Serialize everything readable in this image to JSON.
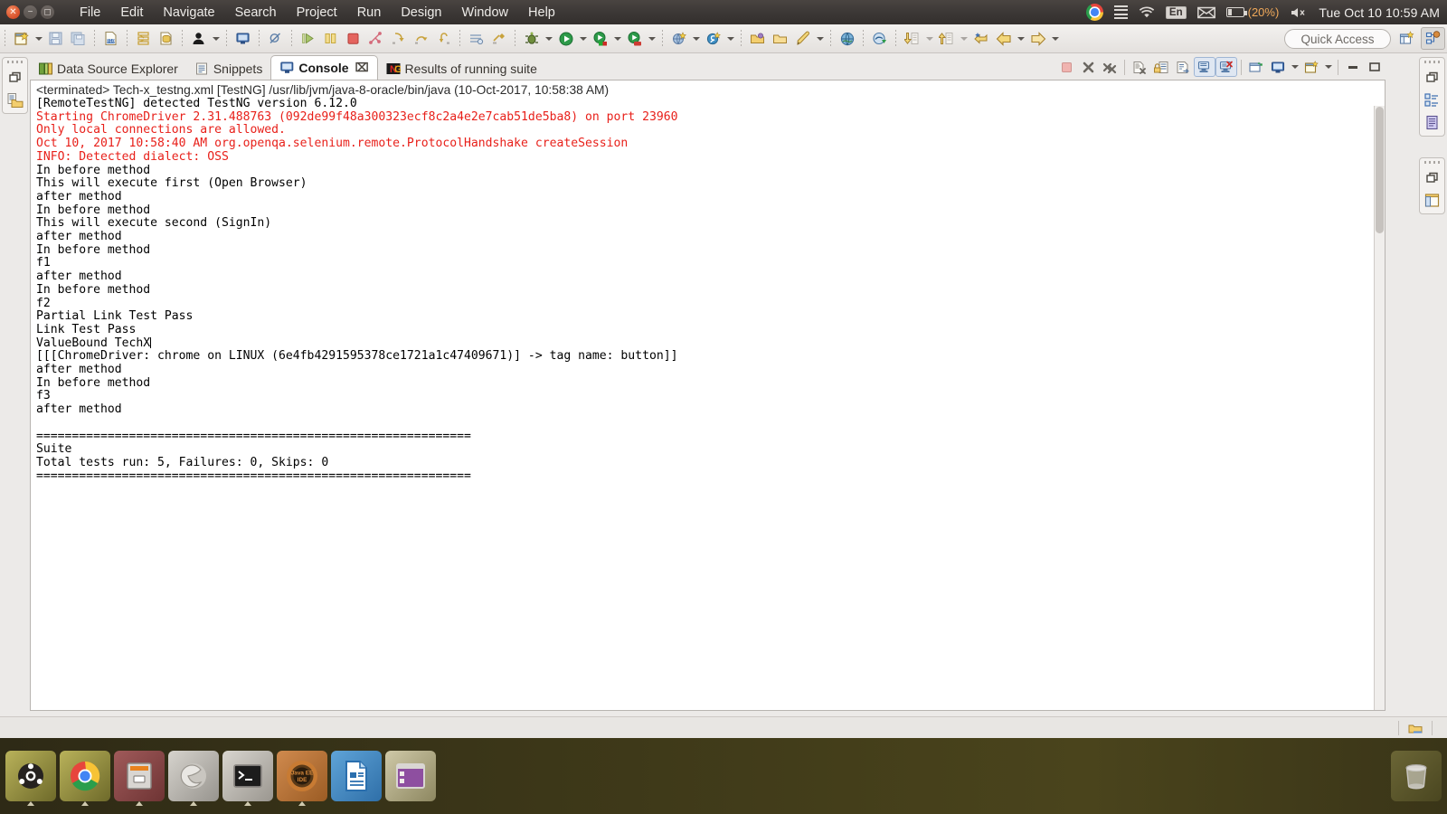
{
  "os_panel": {
    "window_controls": [
      "close",
      "minimize",
      "maximize"
    ],
    "menu": [
      "File",
      "Edit",
      "Navigate",
      "Search",
      "Project",
      "Run",
      "Design",
      "Window",
      "Help"
    ],
    "tray": {
      "chrome_icon": "chrome-icon",
      "messages_icon": "list-icon",
      "network_icon": "wifi-icon",
      "keyboard_layout": "En",
      "mail_icon": "mail-icon",
      "battery_icon": "battery-icon",
      "battery_level": "(20%)",
      "volume_icon": "volume-muted-icon",
      "clock": "Tue Oct 10 10:59 AM"
    }
  },
  "toolbar": {
    "quick_access_placeholder": "Quick Access",
    "items": [
      {
        "name": "new-wizard",
        "icon": "new-file-icon",
        "dropdown": true
      },
      {
        "name": "save",
        "icon": "save-icon",
        "dropdown": false
      },
      {
        "name": "save-all",
        "icon": "save-all-icon",
        "dropdown": false
      },
      {
        "name": "new-sql-file",
        "icon": "sql-file-icon",
        "dropdown": false
      },
      {
        "name": "open-sql-scrapbook",
        "icon": "scrapbook-icon",
        "dropdown": false
      },
      {
        "name": "data-source-explorer",
        "icon": "data-source-icon",
        "dropdown": false
      },
      {
        "name": "user-profile",
        "icon": "person-icon",
        "dropdown": true
      },
      {
        "name": "open-console",
        "icon": "console-icon",
        "dropdown": false
      },
      {
        "name": "skip-breakpoints",
        "icon": "skip-breakpoints-icon",
        "dropdown": false
      },
      {
        "name": "resume",
        "icon": "resume-icon",
        "dropdown": false
      },
      {
        "name": "suspend",
        "icon": "suspend-icon",
        "dropdown": false
      },
      {
        "name": "terminate",
        "icon": "terminate-icon",
        "dropdown": false
      },
      {
        "name": "disconnect",
        "icon": "disconnect-icon",
        "dropdown": false
      },
      {
        "name": "step-into",
        "icon": "step-into-icon",
        "dropdown": false
      },
      {
        "name": "step-over",
        "icon": "step-over-icon",
        "dropdown": false
      },
      {
        "name": "step-return",
        "icon": "step-return-icon",
        "dropdown": false
      },
      {
        "name": "open-type",
        "icon": "open-type-icon",
        "dropdown": false
      },
      {
        "name": "build-all",
        "icon": "build-icon",
        "dropdown": false
      },
      {
        "name": "debug",
        "icon": "debug-bug-icon",
        "dropdown": true
      },
      {
        "name": "run",
        "icon": "run-green-play-icon",
        "dropdown": true
      },
      {
        "name": "coverage",
        "icon": "coverage-icon",
        "dropdown": true
      },
      {
        "name": "profile",
        "icon": "profile-icon",
        "dropdown": true
      },
      {
        "name": "new-web-project",
        "icon": "web-project-icon",
        "dropdown": true
      },
      {
        "name": "new-server",
        "icon": "server-icon",
        "dropdown": true
      },
      {
        "name": "open-resource",
        "icon": "open-folder-icon",
        "dropdown": false
      },
      {
        "name": "open-package",
        "icon": "folder-icon",
        "dropdown": false
      },
      {
        "name": "external-tools",
        "icon": "external-tools-icon",
        "dropdown": true
      },
      {
        "name": "open-browser",
        "icon": "globe-icon",
        "dropdown": false
      },
      {
        "name": "run-testng",
        "icon": "testng-run-icon",
        "dropdown": false
      },
      {
        "name": "next-annotation",
        "icon": "next-annotation-icon",
        "dropdown": true
      },
      {
        "name": "previous-annotation",
        "icon": "previous-annotation-icon",
        "dropdown": true
      },
      {
        "name": "last-edit-location",
        "icon": "last-edit-icon",
        "dropdown": false
      },
      {
        "name": "back",
        "icon": "back-arrow-icon",
        "dropdown": true
      },
      {
        "name": "forward",
        "icon": "forward-arrow-icon",
        "dropdown": true
      }
    ],
    "perspective_new": "open-perspective-icon",
    "perspective_active": "java-ee-perspective-icon"
  },
  "left_fastview": {
    "restore_icon": "restore-icon",
    "items": [
      {
        "name": "project-explorer",
        "icon": "project-explorer-icon"
      }
    ]
  },
  "right_fastview": {
    "stacks": [
      {
        "restore_icon": "restore-icon",
        "items": [
          {
            "name": "outline",
            "icon": "outline-icon"
          },
          {
            "name": "task-list",
            "icon": "task-list-icon"
          }
        ]
      },
      {
        "restore_icon": "restore-icon",
        "items": [
          {
            "name": "properties",
            "icon": "properties-icon"
          }
        ]
      }
    ]
  },
  "view_tabs": [
    {
      "label": "Data Source Explorer",
      "icon": "data-source-explorer-icon",
      "active": false,
      "closable": false
    },
    {
      "label": "Snippets",
      "icon": "snippets-icon",
      "active": false,
      "closable": false
    },
    {
      "label": "Console",
      "icon": "console-view-icon",
      "active": true,
      "closable": true,
      "close_glyph": "⌧"
    },
    {
      "label": "Results of running suite",
      "icon": "testng-icon",
      "active": false,
      "closable": false
    }
  ],
  "view_toolbar": [
    {
      "name": "terminate-console",
      "icon": "terminate-red-icon",
      "toggled": false,
      "disabled": true
    },
    {
      "name": "remove-launch",
      "icon": "remove-x-icon",
      "toggled": false,
      "disabled": false
    },
    {
      "name": "remove-all-terminated",
      "icon": "remove-all-x-icon",
      "toggled": false,
      "disabled": false
    },
    {
      "name": "clear-console",
      "icon": "clear-console-icon",
      "toggled": false,
      "disabled": false
    },
    {
      "name": "scroll-lock",
      "icon": "scroll-lock-icon",
      "toggled": false,
      "disabled": false
    },
    {
      "name": "word-wrap",
      "icon": "word-wrap-icon",
      "toggled": false,
      "disabled": false
    },
    {
      "name": "show-console-on-output",
      "icon": "show-console-stdout-icon",
      "toggled": true,
      "disabled": false
    },
    {
      "name": "show-console-on-error",
      "icon": "show-console-stderr-icon",
      "toggled": true,
      "disabled": false
    },
    {
      "name": "pin-console",
      "icon": "pin-console-icon",
      "toggled": false,
      "disabled": false
    },
    {
      "name": "display-selected-console",
      "icon": "display-console-icon",
      "toggled": false,
      "dropdown": true
    },
    {
      "name": "open-console",
      "icon": "open-console-icon",
      "toggled": false,
      "dropdown": true
    },
    {
      "name": "minimize-view",
      "icon": "minimize-icon",
      "toggled": false,
      "disabled": false
    },
    {
      "name": "maximize-view",
      "icon": "maximize-icon",
      "toggled": false,
      "disabled": false
    }
  ],
  "console": {
    "header": "<terminated> Tech-x_testng.xml [TestNG] /usr/lib/jvm/java-8-oracle/bin/java (10-Oct-2017, 10:58:38 AM)",
    "lines": [
      {
        "text": "[RemoteTestNG] detected TestNG version 6.12.0",
        "stream": "out"
      },
      {
        "text": "Starting ChromeDriver 2.31.488763 (092de99f48a300323ecf8c2a4e2e7cab51de5ba8) on port 23960",
        "stream": "err"
      },
      {
        "text": "Only local connections are allowed.",
        "stream": "err"
      },
      {
        "text": "Oct 10, 2017 10:58:40 AM org.openqa.selenium.remote.ProtocolHandshake createSession",
        "stream": "err"
      },
      {
        "text": "INFO: Detected dialect: OSS",
        "stream": "err"
      },
      {
        "text": "In before method",
        "stream": "out"
      },
      {
        "text": "This will execute first (Open Browser)",
        "stream": "out"
      },
      {
        "text": "after method",
        "stream": "out"
      },
      {
        "text": "In before method",
        "stream": "out"
      },
      {
        "text": "This will execute second (SignIn)",
        "stream": "out"
      },
      {
        "text": "after method",
        "stream": "out"
      },
      {
        "text": "In before method",
        "stream": "out"
      },
      {
        "text": "f1",
        "stream": "out"
      },
      {
        "text": "after method",
        "stream": "out"
      },
      {
        "text": "In before method",
        "stream": "out"
      },
      {
        "text": "f2",
        "stream": "out"
      },
      {
        "text": "Partial Link Test Pass",
        "stream": "out"
      },
      {
        "text": "Link Test Pass",
        "stream": "out"
      },
      {
        "text": "ValueBound TechX",
        "stream": "out",
        "caret": true
      },
      {
        "text": "[[[ChromeDriver: chrome on LINUX (6e4fb4291595378ce1721a1c47409671)] -> tag name: button]]",
        "stream": "out"
      },
      {
        "text": "after method",
        "stream": "out"
      },
      {
        "text": "In before method",
        "stream": "out"
      },
      {
        "text": "f3",
        "stream": "out"
      },
      {
        "text": "after method",
        "stream": "out"
      },
      {
        "text": "",
        "stream": "out"
      },
      {
        "text": "=============================================================",
        "stream": "out"
      },
      {
        "text": "Suite",
        "stream": "out"
      },
      {
        "text": "Total tests run: 5, Failures: 0, Skips: 0",
        "stream": "out"
      },
      {
        "text": "=============================================================",
        "stream": "out"
      }
    ],
    "test_summary": {
      "total_tests_run": 5,
      "failures": 0,
      "skips": 0,
      "suite_name": "Suite"
    }
  },
  "statusbar": {
    "items": [
      {
        "name": "build-status",
        "icon": "build-status-icon"
      }
    ]
  },
  "dock": {
    "items": [
      {
        "name": "ubuntu-dash",
        "icon": "ubuntu-logo-icon",
        "running": false
      },
      {
        "name": "google-chrome",
        "icon": "chrome-icon",
        "running": true
      },
      {
        "name": "files",
        "icon": "files-icon",
        "running": true
      },
      {
        "name": "eclipse",
        "icon": "eclipse-icon",
        "running": true
      },
      {
        "name": "terminal",
        "icon": "terminal-icon",
        "running": true
      },
      {
        "name": "java-ee-ide",
        "icon": "java-ee-ide-icon",
        "running": true
      },
      {
        "name": "libreoffice-writer",
        "icon": "libreoffice-writer-icon",
        "running": false
      },
      {
        "name": "workspace-switcher",
        "icon": "workspace-switcher-icon",
        "running": false
      }
    ],
    "trash": {
      "name": "trash",
      "icon": "trash-icon"
    }
  },
  "colors": {
    "stderr": "#e8201a",
    "stdout": "#000000",
    "panel_bg": "#eceae8",
    "console_bg": "#ffffff",
    "top_panel_bg": "#3c3836",
    "battery_accent": "#f0a95a"
  }
}
